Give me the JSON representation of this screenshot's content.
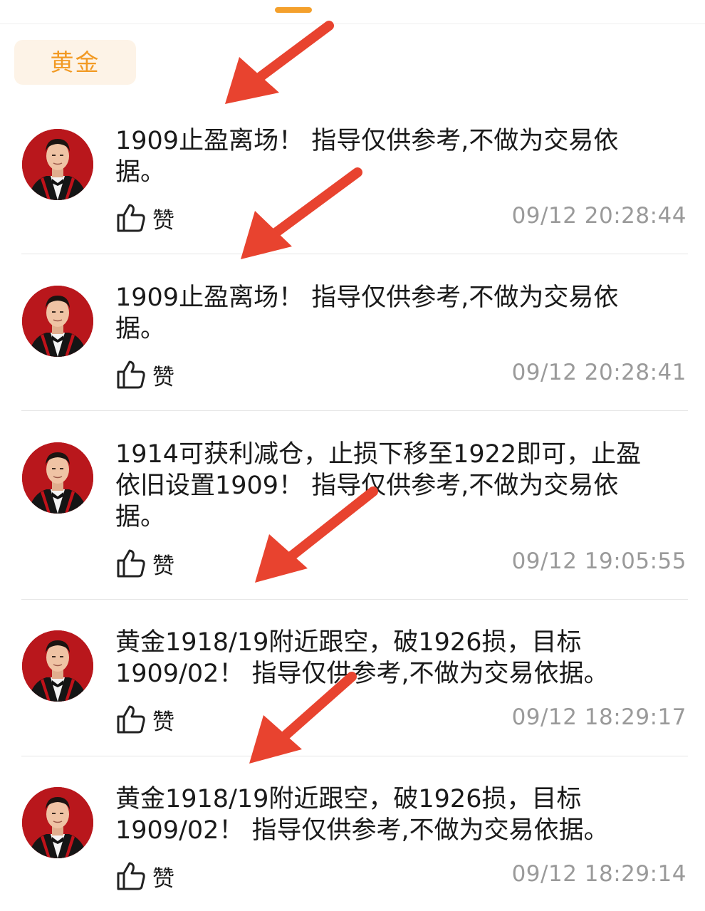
{
  "filter_chip": {
    "label": "黄金"
  },
  "posts": [
    {
      "text": "1909止盈离场！ 指导仅供参考,不做为交易依\n据。",
      "like_label": "赞",
      "timestamp": "09/12 20:28:44"
    },
    {
      "text": "1909止盈离场！ 指导仅供参考,不做为交易依\n据。",
      "like_label": "赞",
      "timestamp": "09/12 20:28:41"
    },
    {
      "text": "1914可获利减仓，止损下移至1922即可，止盈\n依旧设置1909！ 指导仅供参考,不做为交易依\n据。",
      "like_label": "赞",
      "timestamp": "09/12 19:05:55"
    },
    {
      "text": "黄金1918/19附近跟空，破1926损，目标\n1909/02！ 指导仅供参考,不做为交易依据。",
      "like_label": "赞",
      "timestamp": "09/12 18:29:17"
    },
    {
      "text": "黄金1918/19附近跟空，破1926损，目标\n1909/02！ 指导仅供参考,不做为交易依据。",
      "like_label": "赞",
      "timestamp": "09/12 18:29:14"
    }
  ],
  "colors": {
    "accent": "#f29a24",
    "chip_bg": "#fdf3e7",
    "timestamp": "#9a9a9a",
    "annotation_arrow": "#e8432f"
  },
  "icons": {
    "like": "thumbs-up-icon",
    "avatar": "user-avatar-photo",
    "annotation": "red-arrow-annotation"
  }
}
